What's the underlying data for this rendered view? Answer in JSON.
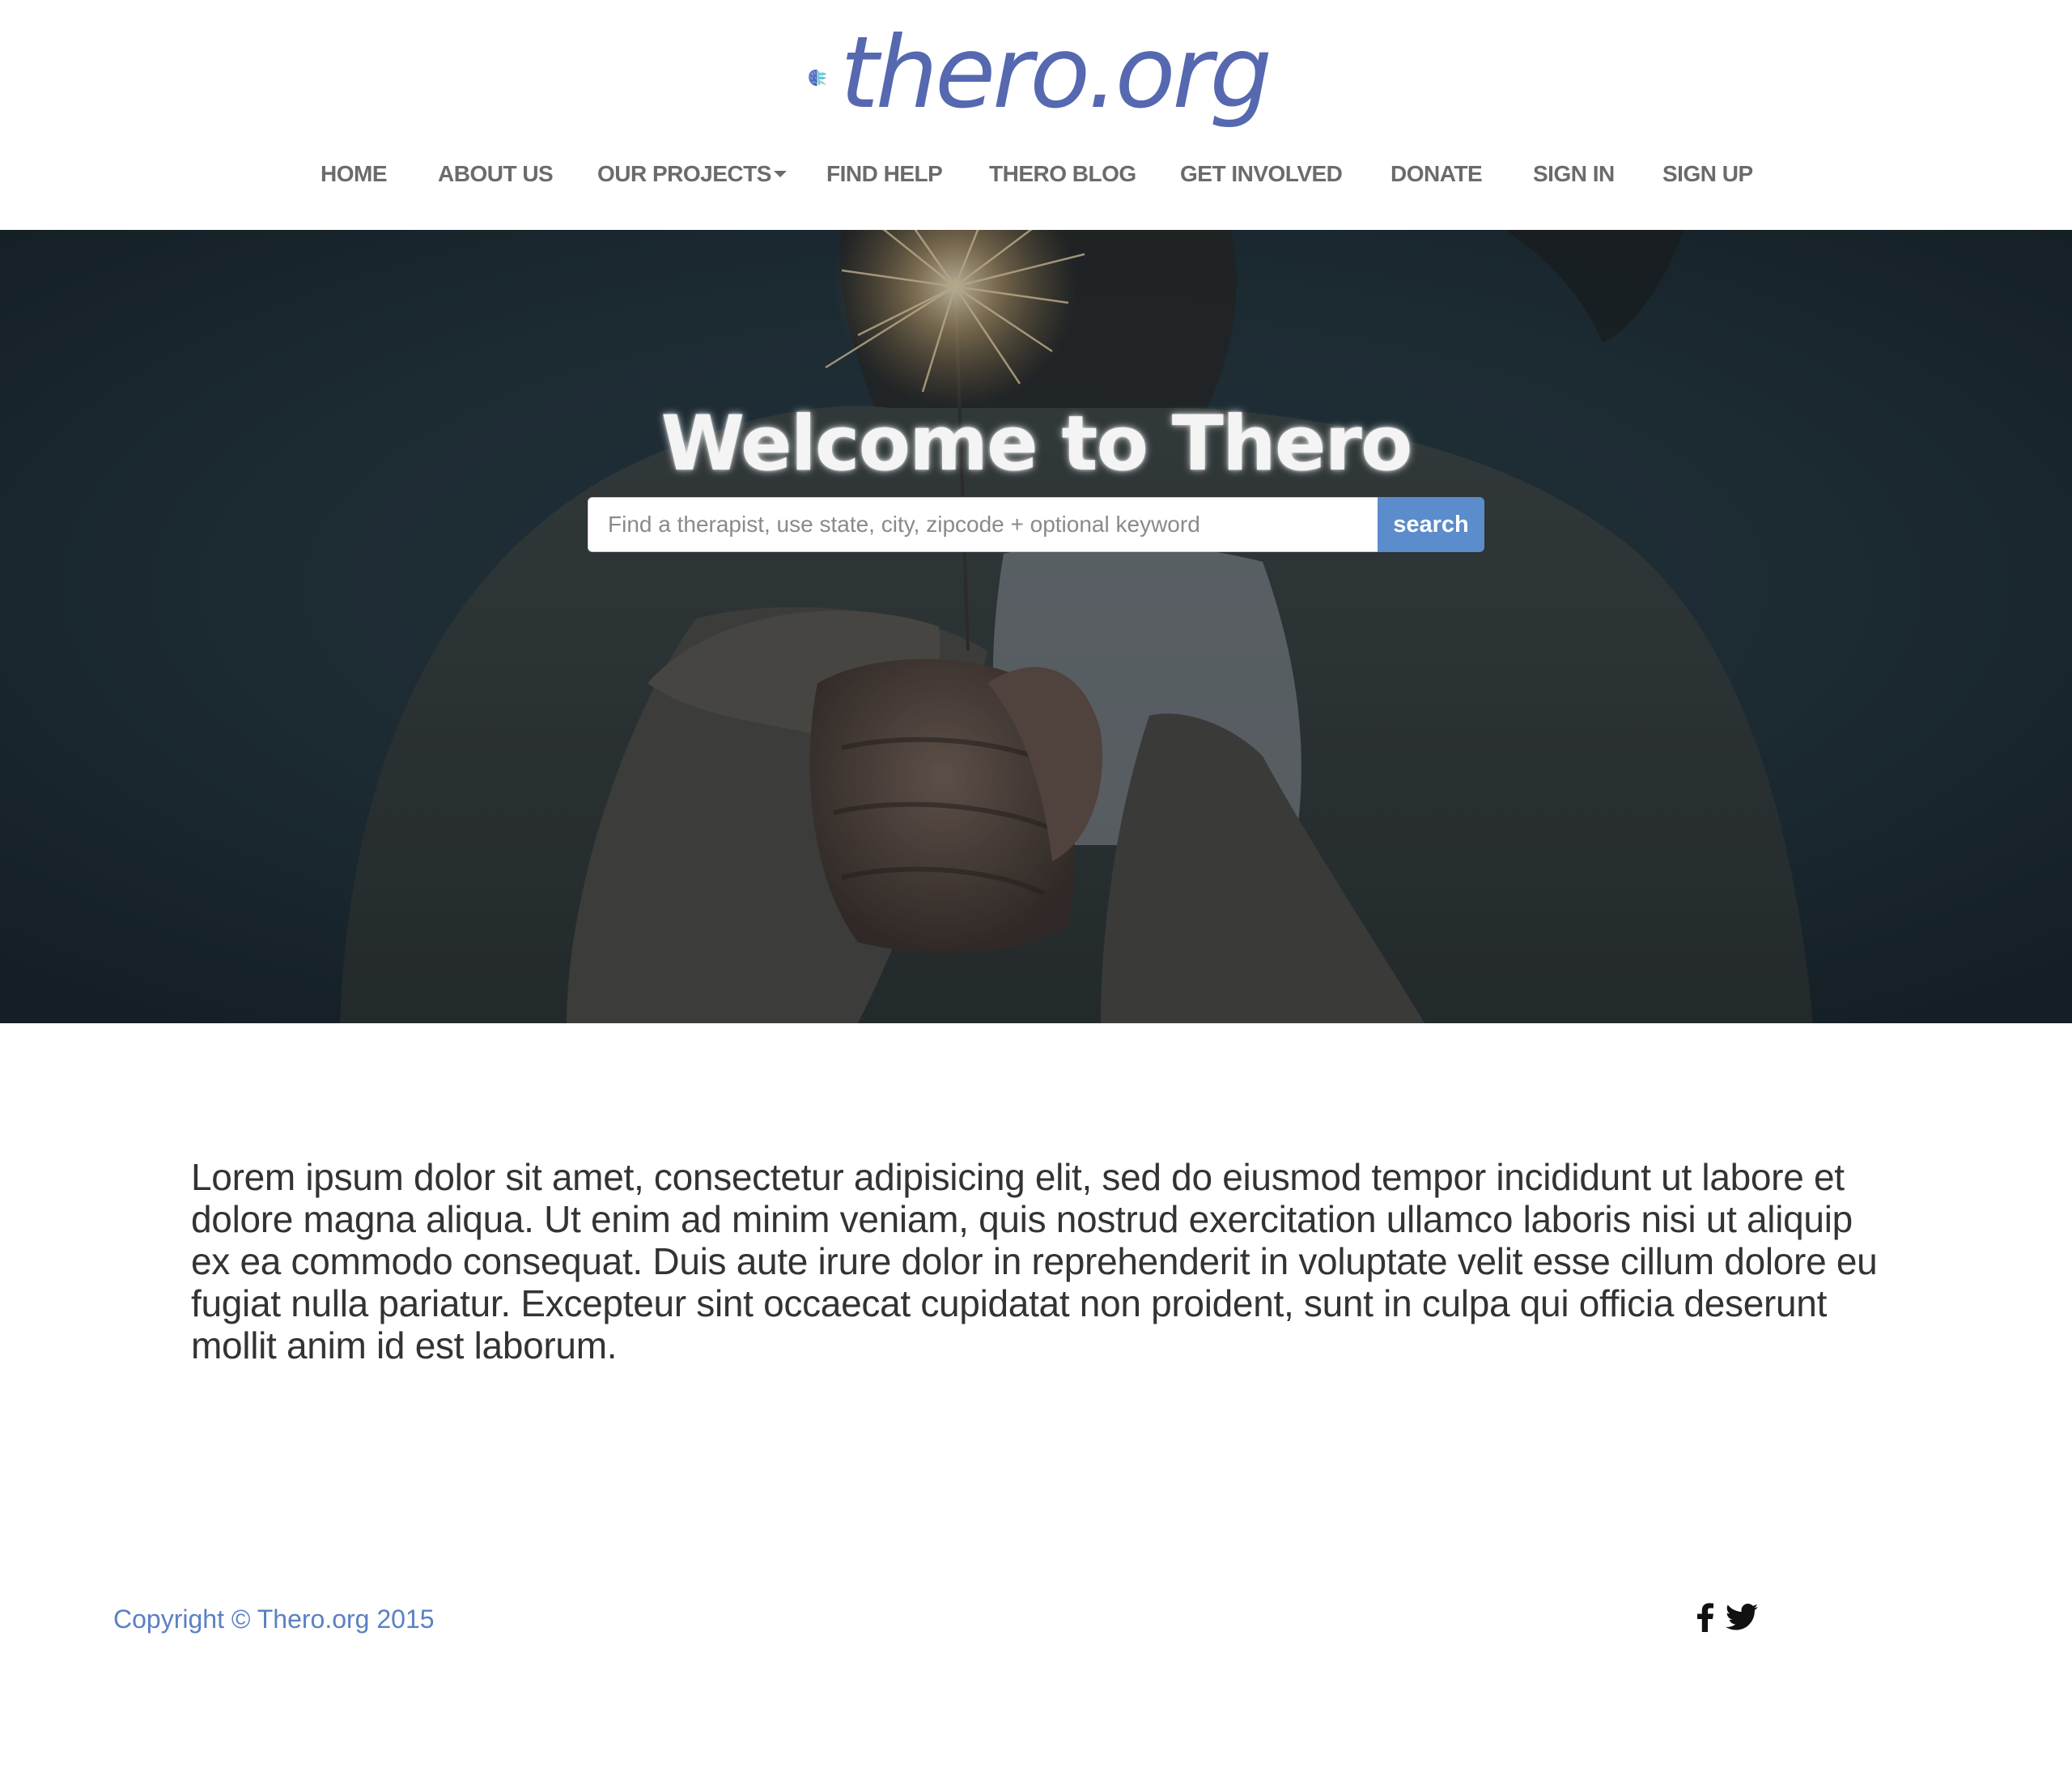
{
  "header": {
    "logo_text": "thero.org",
    "brand_color": "#5568b0",
    "nav": [
      {
        "label": "HOME"
      },
      {
        "label": "ABOUT US"
      },
      {
        "label": "OUR PROJECTS",
        "has_dropdown": true
      },
      {
        "label": "FIND HELP"
      },
      {
        "label": "THERO BLOG"
      },
      {
        "label": "GET INVOLVED"
      },
      {
        "label": "DONATE"
      },
      {
        "label": "SIGN IN"
      },
      {
        "label": "SIGN UP"
      }
    ]
  },
  "hero": {
    "title": "Welcome to Thero",
    "search": {
      "placeholder": "Find a therapist, use state, city, zipcode + optional keyword",
      "value": "",
      "button_label": "search"
    },
    "button_color": "#5b8ccb"
  },
  "main": {
    "paragraph": "Lorem ipsum dolor sit amet, consectetur adipisicing elit, sed do eiusmod tempor incididunt ut labore et dolore magna aliqua. Ut enim ad minim veniam, quis nostrud exercitation ullamco laboris nisi ut aliquip ex ea commodo consequat. Duis aute irure dolor in reprehenderit in voluptate velit esse cillum dolore eu fugiat nulla pariatur. Excepteur sint occaecat cupidatat non proident, sunt in culpa qui officia deserunt mollit anim id est laborum."
  },
  "footer": {
    "copyright": "Copyright © Thero.org 2015",
    "social": [
      {
        "icon": "facebook-icon"
      },
      {
        "icon": "twitter-icon"
      }
    ]
  }
}
